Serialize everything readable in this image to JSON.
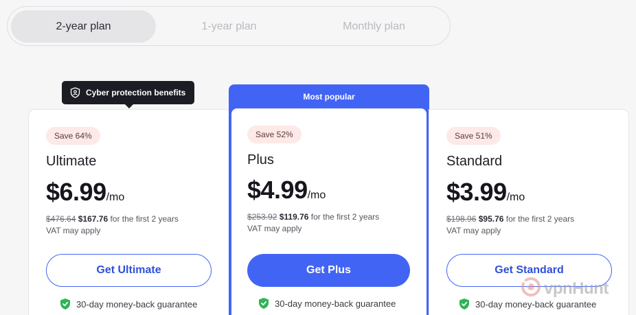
{
  "plan_toggle": {
    "tabs": [
      {
        "label": "2-year plan",
        "active": true
      },
      {
        "label": "1-year plan",
        "active": false
      },
      {
        "label": "Monthly plan",
        "active": false
      }
    ]
  },
  "tooltip": {
    "text": "Cyber protection benefits",
    "icon": "shield-user-icon"
  },
  "popular_label": "Most popular",
  "plans": [
    {
      "save": "Save 64%",
      "name": "Ultimate",
      "price": "$6.99",
      "per": "/mo",
      "old_price": "$476.64",
      "new_price": "$167.76",
      "period": " for the first 2 years",
      "vat": "VAT may apply",
      "cta": "Get Ultimate",
      "guarantee": "30-day money-back guarantee"
    },
    {
      "save": "Save 52%",
      "name": "Plus",
      "price": "$4.99",
      "per": "/mo",
      "old_price": "$253.92",
      "new_price": "$119.76",
      "period": " for the first 2 years",
      "vat": "VAT may apply",
      "cta": "Get Plus",
      "guarantee": "30-day money-back guarantee"
    },
    {
      "save": "Save 51%",
      "name": "Standard",
      "price": "$3.99",
      "per": "/mo",
      "old_price": "$198.96",
      "new_price": "$95.76",
      "period": " for the first 2 years",
      "vat": "VAT may apply",
      "cta": "Get Standard",
      "guarantee": "30-day money-back guarantee"
    }
  ],
  "watermark": {
    "text": "vpnHunt"
  },
  "colors": {
    "accent": "#4264f5",
    "badge_bg": "#fde9e7",
    "guarantee_icon": "#2fb457",
    "tooltip_bg": "#1c1c24"
  }
}
